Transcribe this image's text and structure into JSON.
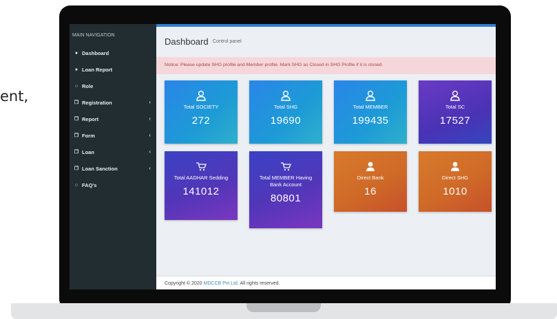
{
  "background": {
    "partial_text": "ent,"
  },
  "sidebar": {
    "header": "MAIN NAVIGATION",
    "items": [
      {
        "label": "Dashboard",
        "icon": "dashboard-icon",
        "has_chevron": false
      },
      {
        "label": "Loan Report",
        "icon": "dashboard-icon",
        "has_chevron": false
      },
      {
        "label": "Role",
        "icon": "circle-icon",
        "has_chevron": false
      },
      {
        "label": "Registration",
        "icon": "files-icon",
        "has_chevron": true
      },
      {
        "label": "Report",
        "icon": "files-icon",
        "has_chevron": true
      },
      {
        "label": "Form",
        "icon": "files-icon",
        "has_chevron": true
      },
      {
        "label": "Loan",
        "icon": "files-icon",
        "has_chevron": true
      },
      {
        "label": "Loan Sanction",
        "icon": "files-icon",
        "has_chevron": true
      },
      {
        "label": "FAQ's",
        "icon": "circle-icon",
        "has_chevron": false
      }
    ],
    "chevron_glyph": "‹"
  },
  "header": {
    "title": "Dashboard",
    "subtitle": "Control panel"
  },
  "notice": "Notice: Please update SHG profile and Member profile. Mark SHG as Closed in SHG Profile if it is closed.",
  "tiles": [
    {
      "label": "Total SOCIETY",
      "value": "272",
      "icon": "user-icon",
      "gradient": "blue"
    },
    {
      "label": "Total SHG",
      "value": "19690",
      "icon": "user-icon",
      "gradient": "blue"
    },
    {
      "label": "Total MEMBER",
      "value": "199435",
      "icon": "user-icon",
      "gradient": "blue"
    },
    {
      "label": "Total SC",
      "value": "17527",
      "icon": "user-icon",
      "gradient": "purple"
    },
    {
      "label": "Total AADHAR Sedding",
      "value": "141012",
      "icon": "cart-icon",
      "gradient": "purple"
    },
    {
      "label": "Total MEMBER Having Bank Account",
      "value": "80801",
      "icon": "cart-icon",
      "gradient": "purple"
    },
    {
      "label": "Direct Bank",
      "value": "16",
      "icon": "user-solid-icon",
      "gradient": "orange"
    },
    {
      "label": "Direct SHG",
      "value": "1010",
      "icon": "user-solid-icon",
      "gradient": "orange"
    }
  ],
  "footer": {
    "prefix": "Copyright © 2020 ",
    "company": "MDCCB Pvt Ltd",
    "suffix": ". All rights reserved."
  },
  "colors": {
    "sidebar_bg": "#222d32",
    "accent": "#2f80d1",
    "notice_bg": "#f5d7db",
    "notice_text": "#a94442",
    "link": "#3c8dbc"
  }
}
